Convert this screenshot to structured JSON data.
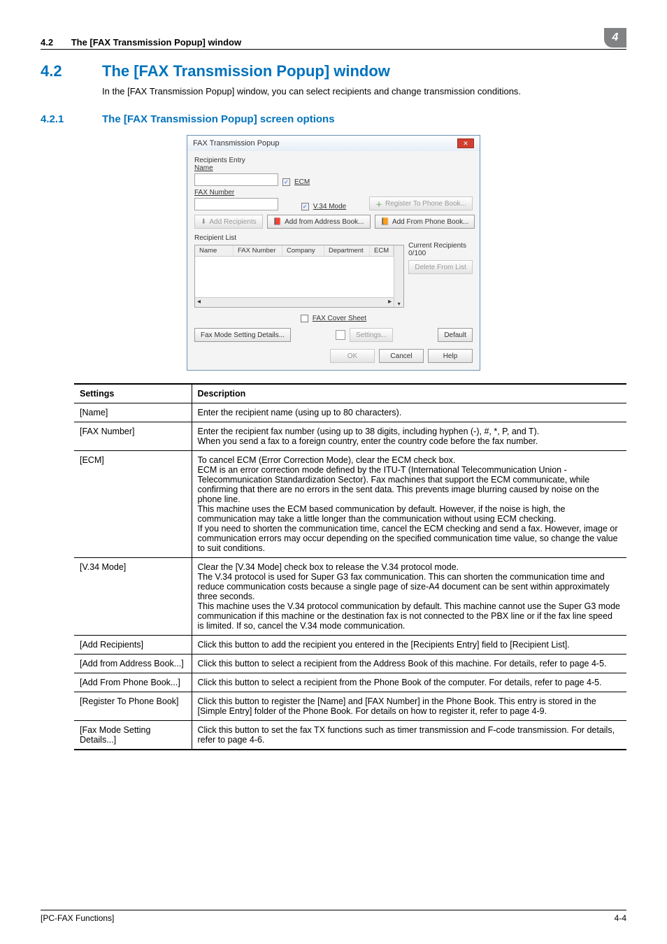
{
  "header": {
    "section_no": "4.2",
    "section_title": "The [FAX Transmission Popup] window",
    "chapter_badge": "4"
  },
  "h2": {
    "no": "4.2",
    "title": "The [FAX Transmission Popup] window"
  },
  "intro": "In the [FAX Transmission Popup] window, you can select recipients and change transmission conditions.",
  "h3": {
    "no": "4.2.1",
    "title": "The [FAX Transmission Popup] screen options"
  },
  "dialog": {
    "title": "FAX Transmission Popup",
    "recipients_entry_label": "Recipients Entry",
    "name_label": "Name",
    "ecm_label": "ECM",
    "fax_number_label": "FAX Number",
    "v34_label": "V.34 Mode",
    "register_phone_book": "Register To Phone Book...",
    "add_recipients": "Add Recipients",
    "add_from_address_book": "Add from Address Book...",
    "add_from_phone_book": "Add From Phone Book...",
    "recipient_list_label": "Recipient List",
    "cols": {
      "name": "Name",
      "fax": "FAX Number",
      "company": "Company",
      "dept": "Department",
      "ecm": "ECM"
    },
    "current_recipients": "Current Recipients 0/100",
    "delete_from_list": "Delete From List",
    "fax_cover_sheet": "FAX Cover Sheet",
    "settings_btn": "Settings...",
    "fax_mode_details": "Fax Mode Setting Details...",
    "default_btn": "Default",
    "ok": "OK",
    "cancel": "Cancel",
    "help": "Help"
  },
  "table": {
    "head_settings": "Settings",
    "head_desc": "Description",
    "rows": [
      {
        "s": "[Name]",
        "d": "Enter the recipient name (using up to 80 characters)."
      },
      {
        "s": "[FAX Number]",
        "d": "Enter the recipient fax number (using up to 38 digits, including hyphen (-), #, *, P, and T).\nWhen you send a fax to a foreign country, enter the country code before the fax number."
      },
      {
        "s": "[ECM]",
        "d": "To cancel ECM (Error Correction Mode), clear the ECM check box.\nECM is an error correction mode defined by the ITU-T (International Telecommunication Union - Telecommunication Standardization Sector). Fax machines that support the ECM communicate, while confirming that there are no errors in the sent data. This prevents image blurring caused by noise on the phone line.\nThis machine uses the ECM based communication by default. However, if the noise is high, the communication may take a little longer than the communication without using ECM checking.\nIf you need to shorten the communication time, cancel the ECM checking and send a fax. However, image or communication errors may occur depending on the specified communication time value, so change the value to suit conditions."
      },
      {
        "s": "[V.34 Mode]",
        "d": "Clear the [V.34 Mode] check box to release the V.34 protocol mode.\nThe V.34 protocol is used for Super G3 fax communication. This can shorten the communication time and reduce communication costs because a single page of size-A4 document can be sent within approximately three seconds.\nThis machine uses the V.34 protocol communication by default. This machine cannot use the Super G3 mode communication if this machine or the destination fax is not connected to the PBX line or if the fax line speed is limited. If so, cancel the V.34 mode communication."
      },
      {
        "s": "[Add Recipients]",
        "d": "Click this button to add the recipient you entered in the [Recipients Entry] field to [Recipient List]."
      },
      {
        "s": "[Add from Address Book...]",
        "d": "Click this button to select a recipient from the Address Book of this machine. For details, refer to page 4-5."
      },
      {
        "s": "[Add From Phone Book...]",
        "d": "Click this button to select a recipient from the Phone Book of the computer. For details, refer to page 4-5."
      },
      {
        "s": "[Register To Phone Book]",
        "d": "Click this button to register the [Name] and [FAX Number] in the Phone Book. This entry is stored in the [Simple Entry] folder of the Phone Book. For details on how to register it, refer to page 4-9."
      },
      {
        "s": "[Fax Mode Setting Details...]",
        "d": "Click this button to set the fax TX functions such as timer transmission and F-code transmission. For details, refer to page 4-6."
      }
    ]
  },
  "footer": {
    "left": "[PC-FAX Functions]",
    "right": "4-4"
  }
}
